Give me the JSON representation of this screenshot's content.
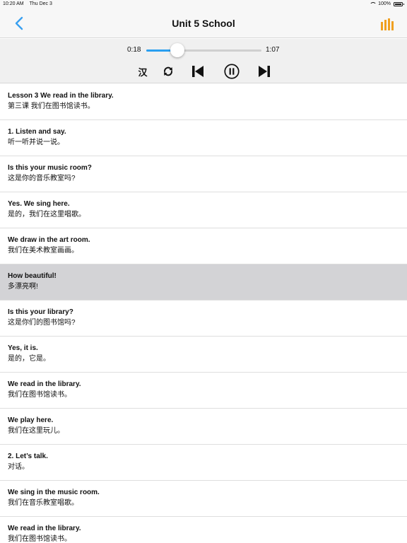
{
  "statusbar": {
    "time": "10:20 AM",
    "date": "Thu Dec 3",
    "battery": "100%"
  },
  "navbar": {
    "title": "Unit 5 School",
    "back_icon": "chevron-left-icon",
    "right_icon": "bar-chart-icon",
    "accent": "#3aa0f0",
    "chart_color": "#f0a020"
  },
  "player": {
    "current_time": "0:18",
    "duration": "1:07",
    "progress": 0.27,
    "han_label": "汉",
    "controls": [
      "repeat-icon",
      "previous-icon",
      "pause-icon",
      "next-icon"
    ],
    "track_color": "#2a9ff0"
  },
  "lessons": [
    {
      "en": "Lesson 3 We read in the library.",
      "zh": "第三课 我们在图书馆读书。",
      "active": false
    },
    {
      "en": "1. Listen and say.",
      "zh": "听一听并说一说。",
      "active": false
    },
    {
      "en": "Is this your music room?",
      "zh": "这是你的音乐教室吗?",
      "active": false
    },
    {
      "en": "Yes. We sing here.",
      "zh": "是的，我们在这里唱歌。",
      "active": false
    },
    {
      "en": "We draw in the art room.",
      "zh": "我们在美术教室画画。",
      "active": false
    },
    {
      "en": "How beautiful!",
      "zh": "多漂亮啊!",
      "active": true
    },
    {
      "en": "Is this your library?",
      "zh": "这是你们的图书馆吗?",
      "active": false
    },
    {
      "en": "Yes, it is.",
      "zh": "是的，它是。",
      "active": false
    },
    {
      "en": "We read in the library.",
      "zh": "我们在图书馆读书。",
      "active": false
    },
    {
      "en": "We play here.",
      "zh": "我们在这里玩儿。",
      "active": false
    },
    {
      "en": "2. Let’s talk.",
      "zh": "对话。",
      "active": false
    },
    {
      "en": "We sing in the music room.",
      "zh": "我们在音乐教室唱歌。",
      "active": false
    },
    {
      "en": "We read in the library.",
      "zh": "我们在图书馆读书。",
      "active": false
    }
  ]
}
